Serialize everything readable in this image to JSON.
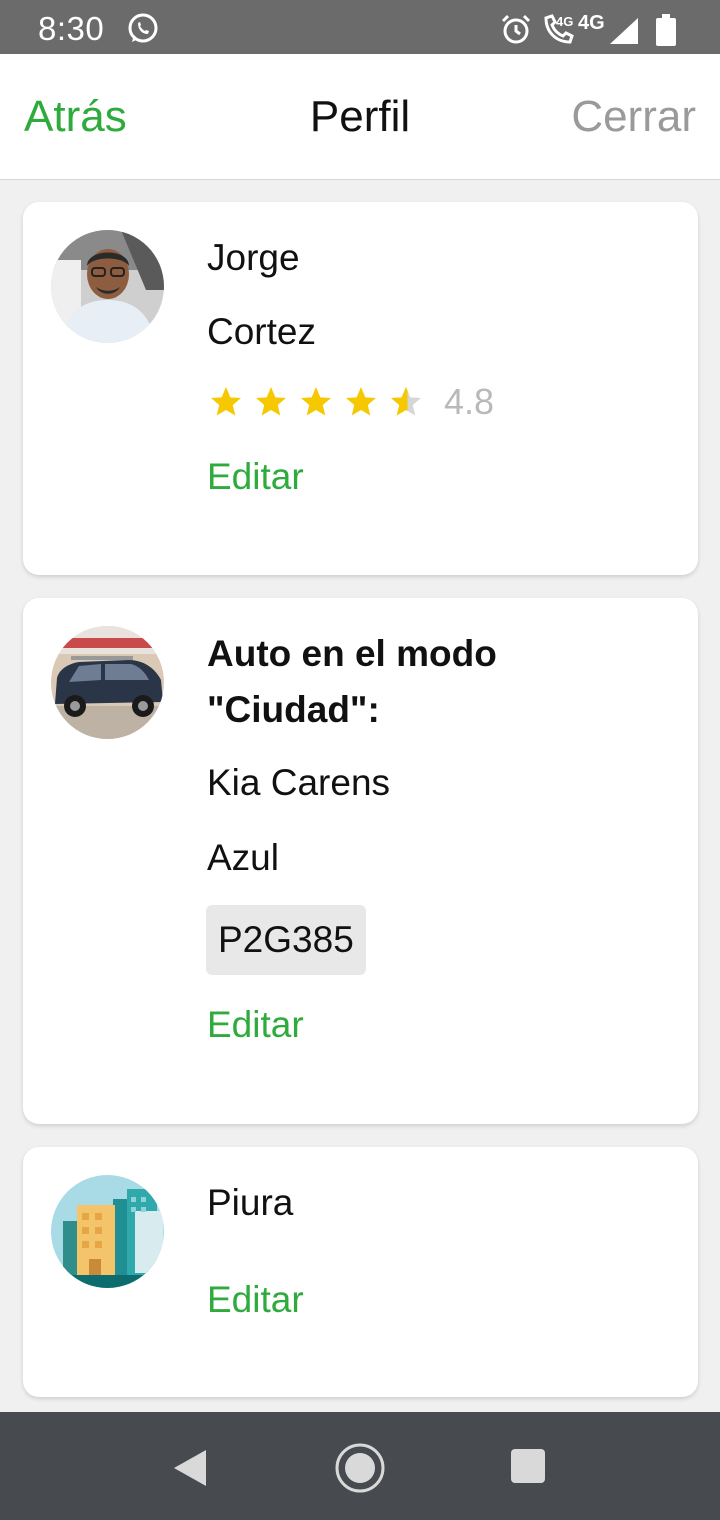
{
  "status_bar": {
    "time": "8:30",
    "network_small": "4G",
    "network": "4G"
  },
  "header": {
    "back_label": "Atrás",
    "title": "Perfil",
    "close_label": "Cerrar"
  },
  "driver": {
    "first_name": "Jorge",
    "last_name": "Cortez",
    "rating": 4.8,
    "rating_text": "4.8",
    "edit_label": "Editar"
  },
  "car": {
    "heading_line1": "Auto en el modo",
    "heading_line2": "\"Ciudad\":",
    "model": "Kia Carens",
    "color_name": "Azul",
    "plate": "P2G385",
    "edit_label": "Editar"
  },
  "city": {
    "name": "Piura",
    "edit_label": "Editar"
  },
  "colors": {
    "accent": "#2faa3d",
    "star": "#f5c800",
    "close": "#9a9a9a",
    "status_bar": "#6b6b6b",
    "nav_bar": "#474b50"
  },
  "icons": [
    "whatsapp-icon",
    "alarm-icon",
    "call-icon",
    "signal-icon",
    "battery-icon",
    "star-icon",
    "back-triangle-icon",
    "home-circle-icon",
    "recents-square-icon"
  ]
}
